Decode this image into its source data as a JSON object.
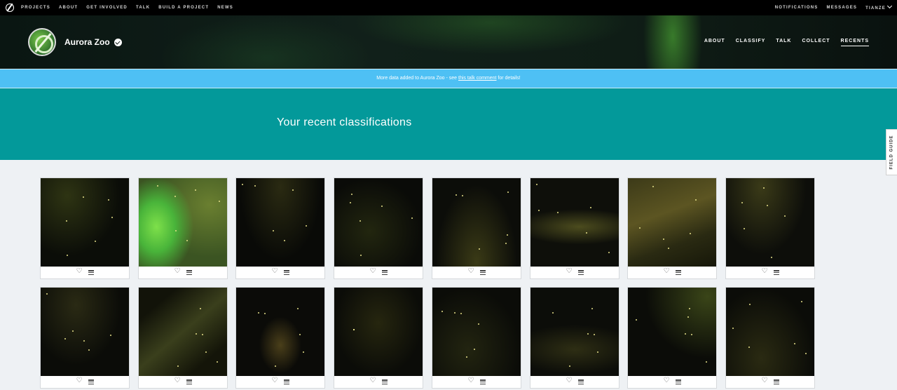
{
  "site_nav": {
    "left": [
      "PROJECTS",
      "ABOUT",
      "GET INVOLVED",
      "TALK",
      "BUILD A PROJECT",
      "NEWS"
    ],
    "right": [
      "NOTIFICATIONS",
      "MESSAGES",
      "TIANZE"
    ]
  },
  "project": {
    "name": "Aurora Zoo",
    "nav": [
      "ABOUT",
      "CLASSIFY",
      "TALK",
      "COLLECT",
      "RECENTS"
    ],
    "active_nav": "RECENTS"
  },
  "banner": {
    "before": "More data added to Aurora Zoo - see ",
    "link": "this talk comment",
    "after": " for details!"
  },
  "hero": {
    "title": "Your recent classifications"
  },
  "field_guide": {
    "label": "FIELD GUIDE"
  },
  "colors": {
    "banner": "#4ec0f4",
    "hero": "#03999a",
    "page_bg": "#eef1f4"
  },
  "classifications": [
    {
      "style": "t0"
    },
    {
      "style": "t1"
    },
    {
      "style": "t2"
    },
    {
      "style": "t3"
    },
    {
      "style": "t4"
    },
    {
      "style": "t5"
    },
    {
      "style": "t6"
    },
    {
      "style": "t7"
    },
    {
      "style": "t8"
    },
    {
      "style": "t9"
    },
    {
      "style": "t10"
    },
    {
      "style": "t11"
    },
    {
      "style": "t12"
    },
    {
      "style": "t13"
    },
    {
      "style": "t14"
    },
    {
      "style": "t15"
    }
  ],
  "card_actions": {
    "favorite_icon": "heart-icon",
    "collect_icon": "list-icon"
  }
}
